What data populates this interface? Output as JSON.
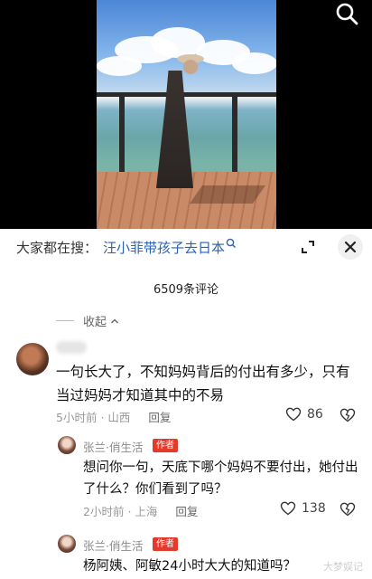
{
  "search": {
    "prefix": "大家都在搜：",
    "term": "汪小菲带孩子去日本",
    "icons": [
      "search-icon",
      "expand-icon",
      "close-icon"
    ]
  },
  "comments_header": {
    "count": "6509条评论",
    "collapse_label": "收起"
  },
  "comment": {
    "text": "一句长大了，不知妈妈背后的付出有多少，只有当过妈妈才知道其中的不易",
    "time": "5小时前",
    "location": "山西",
    "reply_label": "回复",
    "likes": "86"
  },
  "replies": [
    {
      "name": "张兰·俏生活",
      "tag": "作者",
      "text": "想问你一句，天底下哪个妈妈不要付出，她付出了什么？你们看到了吗？",
      "time": "2小时前",
      "location": "上海",
      "reply_label": "回复",
      "likes": "138"
    },
    {
      "name": "张兰·俏生活",
      "tag": "作者",
      "text": "杨阿姨、阿敏24小时大大的知道吗？"
    }
  ],
  "watermark": "大梦娱记",
  "colors": {
    "link": "#2b63b4",
    "author_tag": "#e4392b"
  }
}
